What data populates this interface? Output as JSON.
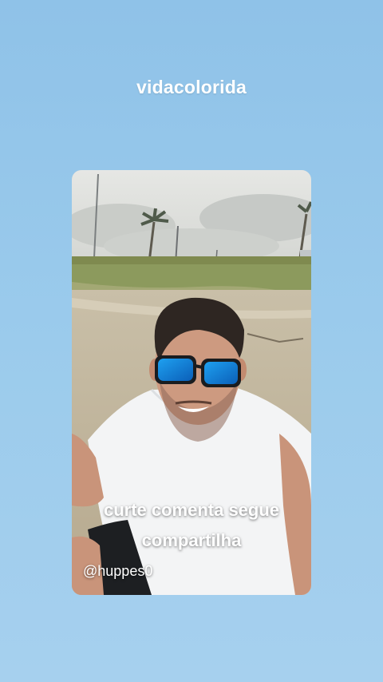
{
  "story": {
    "title": "vidacolorida",
    "caption_line1": "curte comenta segue",
    "caption_line2": "compartilha",
    "handle": "@huppes0"
  },
  "colors": {
    "background": "#9bcbec",
    "text": "#ffffff"
  }
}
